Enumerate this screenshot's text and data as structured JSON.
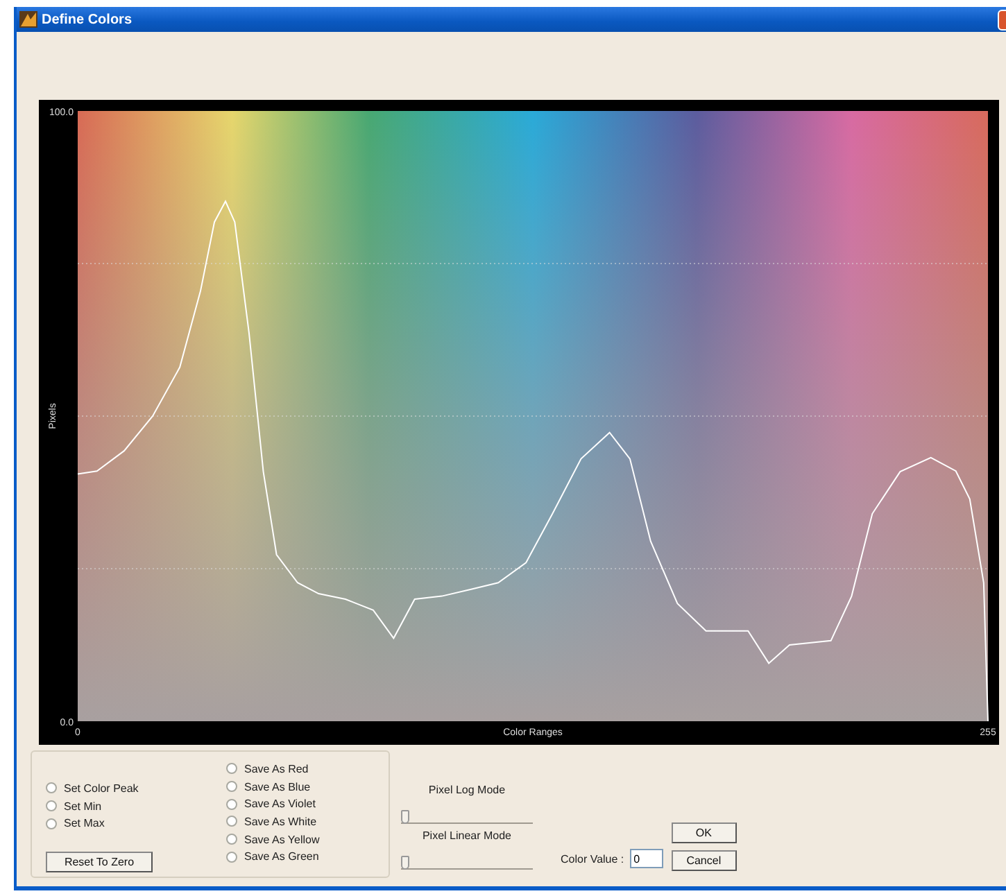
{
  "window": {
    "title": "Define Colors"
  },
  "chart": {
    "chart_data": {
      "type": "line",
      "xlabel": "Color Ranges",
      "ylabel": "Pixels",
      "xlim": [
        0,
        255
      ],
      "ylim": [
        0,
        100
      ],
      "xticks": [
        0,
        255
      ],
      "yticks": [
        {
          "value": 0,
          "label": "0.0"
        },
        {
          "value": 100,
          "label": "100.0"
        }
      ],
      "x": [
        0,
        5.4,
        13,
        21,
        28.6,
        34.4,
        38.3,
        41.4,
        44,
        48,
        52,
        55.7,
        61.6,
        67.5,
        75,
        82.8,
        88.5,
        94.4,
        102,
        110,
        117.8,
        125.6,
        133,
        141,
        149,
        154.7,
        160.5,
        168,
        176,
        187.8,
        193.6,
        199.4,
        211,
        216.8,
        222.6,
        230.4,
        239,
        246,
        249.9,
        253.8,
        255
      ],
      "series": [
        {
          "color": "#ffffff",
          "values": [
            40.5,
            41,
            44.3,
            50,
            58,
            70.5,
            81.8,
            85.2,
            81.8,
            63.6,
            40.9,
            27.3,
            22.7,
            20.9,
            20,
            18.2,
            13.6,
            20,
            20.5,
            21.6,
            22.7,
            26,
            34,
            43,
            47.3,
            43,
            29.5,
            19.3,
            14.8,
            14.8,
            9.5,
            12.5,
            13.2,
            20.5,
            34,
            40.9,
            43.2,
            41,
            36.4,
            22.7,
            0
          ]
        }
      ]
    }
  },
  "peak_options": [
    {
      "label": "Set Color Peak",
      "selected": false
    },
    {
      "label": "Set Min",
      "selected": false
    },
    {
      "label": "Set Max",
      "selected": false
    }
  ],
  "reset_button": "Reset To Zero",
  "save_options": [
    {
      "label": "Save As Red",
      "selected": false
    },
    {
      "label": "Save As Blue",
      "selected": false
    },
    {
      "label": "Save As Violet",
      "selected": false
    },
    {
      "label": "Save As White",
      "selected": false
    },
    {
      "label": "Save As Yellow",
      "selected": false
    },
    {
      "label": "Save As Green",
      "selected": false
    }
  ],
  "sliders": [
    {
      "label": "Pixel Log Mode",
      "level": 0
    },
    {
      "label": "Pixel Linear Mode",
      "level": 0
    }
  ],
  "color_value": {
    "label": "Color Value :",
    "value": "0"
  },
  "buttons": [
    "OK",
    "Cancel"
  ]
}
